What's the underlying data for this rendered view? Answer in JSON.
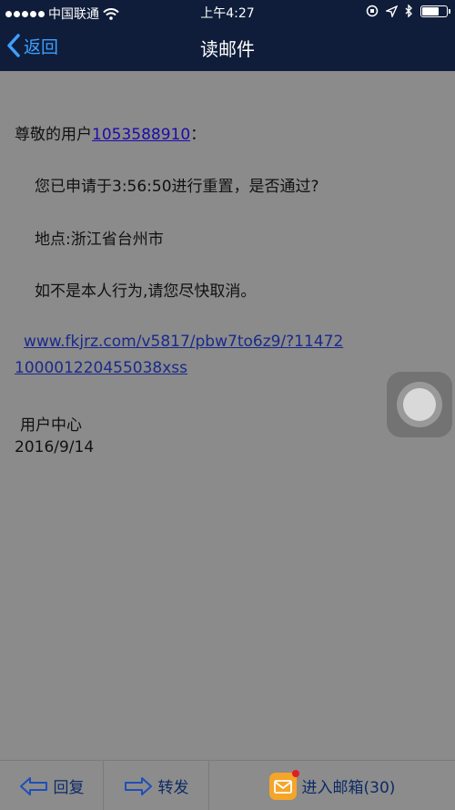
{
  "status_bar": {
    "carrier": "中国联通",
    "time": "上午4:27"
  },
  "nav": {
    "back_label": "返回",
    "title": "读邮件"
  },
  "email": {
    "greeting_prefix": "尊敬的用户",
    "user_id": "1053588910",
    "greeting_suffix": "：",
    "line1": "您已申请于3:56:50进行重置，是否通过?",
    "line2": "地点:浙江省台州市",
    "line3": "如不是本人行为,请您尽快取消。",
    "url_part1": "www.fkjrz.com/v5817/pbw7to6z9/?11472",
    "url_part2": "100001220455038xss",
    "signature": "用户中心",
    "date": "2016/9/14"
  },
  "toolbar": {
    "reply_label": "回复",
    "forward_label": "转发",
    "inbox_label": "进入邮箱(30)"
  },
  "colors": {
    "nav_background": "#0f1d3a",
    "back_accent": "#3ea0ff",
    "link": "#1a0dab"
  }
}
